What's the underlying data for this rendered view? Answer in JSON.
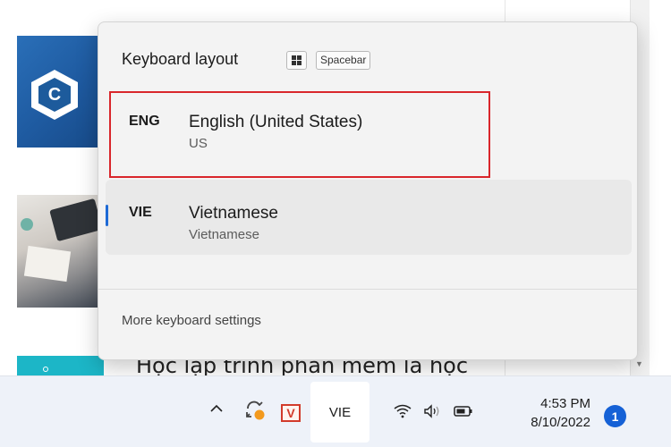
{
  "background": {
    "article_heading": "Học lập trình phần mềm là học"
  },
  "flyout": {
    "title": "Keyboard layout",
    "shortcut_key_win": "win",
    "shortcut_key_space": "Spacebar",
    "languages": [
      {
        "code": "ENG",
        "name": "English (United States)",
        "layout": "US",
        "highlighted": true
      },
      {
        "code": "VIE",
        "name": "Vietnamese",
        "layout": "Vietnamese",
        "selected": true
      }
    ],
    "more_settings": "More keyboard settings"
  },
  "taskbar": {
    "language_indicator": "VIE",
    "vapp_label": "V",
    "time": "4:53 PM",
    "date": "8/10/2022",
    "notification_count": "1"
  },
  "colors": {
    "highlight_border": "#d9262b",
    "selection_accent": "#1e6ad6",
    "notification_badge": "#1561d6"
  }
}
